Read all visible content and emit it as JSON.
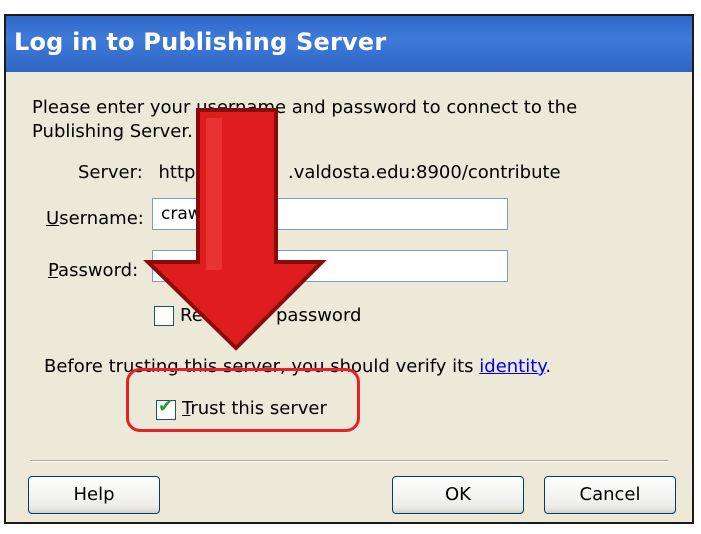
{
  "dialog": {
    "title": "Log in to Publishing Server",
    "intro": "Please enter your username and password to connect to the Publishing Server.",
    "server_label": "Server:",
    "server_value_start": "https",
    "server_value_end": ".valdosta.edu:8900/contribute",
    "username_label_first": "U",
    "username_label_rest": "sername:",
    "username_value": "craw",
    "password_label_first": "P",
    "password_label_rest": "assword:",
    "password_value": "●●●",
    "remember_start": "Re",
    "remember_end": "password",
    "trust_notice_text": "Before trusting this server, you should verify its ",
    "trust_notice_link": "identity",
    "trust_notice_end": ".",
    "trust_label_first": "T",
    "trust_label_rest": "rust this server",
    "trust_checked": true,
    "remember_checked": false
  },
  "buttons": {
    "help": "Help",
    "ok": "OK",
    "cancel": "Cancel"
  },
  "annotation": {
    "arrow_color": "#e01d1d",
    "highlight_color": "#e8202a"
  }
}
